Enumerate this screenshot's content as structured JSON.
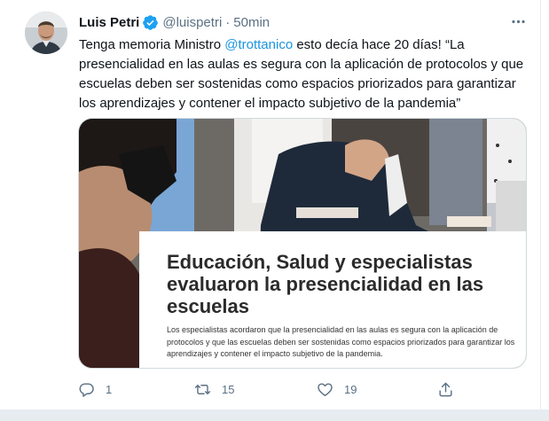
{
  "tweet": {
    "author_name": "Luis Petri",
    "handle": "@luispetri",
    "separator": "·",
    "time": "50min",
    "text_before_mention": "Tenga memoria Ministro ",
    "mention": "@trottanico",
    "text_after_mention": " esto decía hace 20 días! “La presencialidad en las aulas es segura con la aplicación de protocolos y que escuelas deben ser sostenidas como espacios priorizados para garantizar los aprendizajes y contener el impacto subjetivo de la pandemia”",
    "icons": {
      "verified": "verified-badge-icon",
      "more": "more-options-icon",
      "reply": "reply-icon",
      "retweet": "retweet-icon",
      "like": "like-icon",
      "share": "share-icon"
    }
  },
  "card": {
    "headline": "Educación, Salud y especialistas evaluaron la presencialidad en las escuelas",
    "summary": "Los especialistas acordaron que la presencialidad en las aulas es segura con la aplicación de protocolos y que las escuelas deben ser sostenidas como espacios priorizados para garantizar los aprendizajes y contener el impacto subjetivo de la pandemia."
  },
  "actions": {
    "reply_count": "1",
    "retweet_count": "15",
    "like_count": "19"
  },
  "colors": {
    "link": "#1b95e0",
    "verified": "#1da1f2",
    "secondary_text": "#5b7083",
    "border": "#cfd9de"
  }
}
